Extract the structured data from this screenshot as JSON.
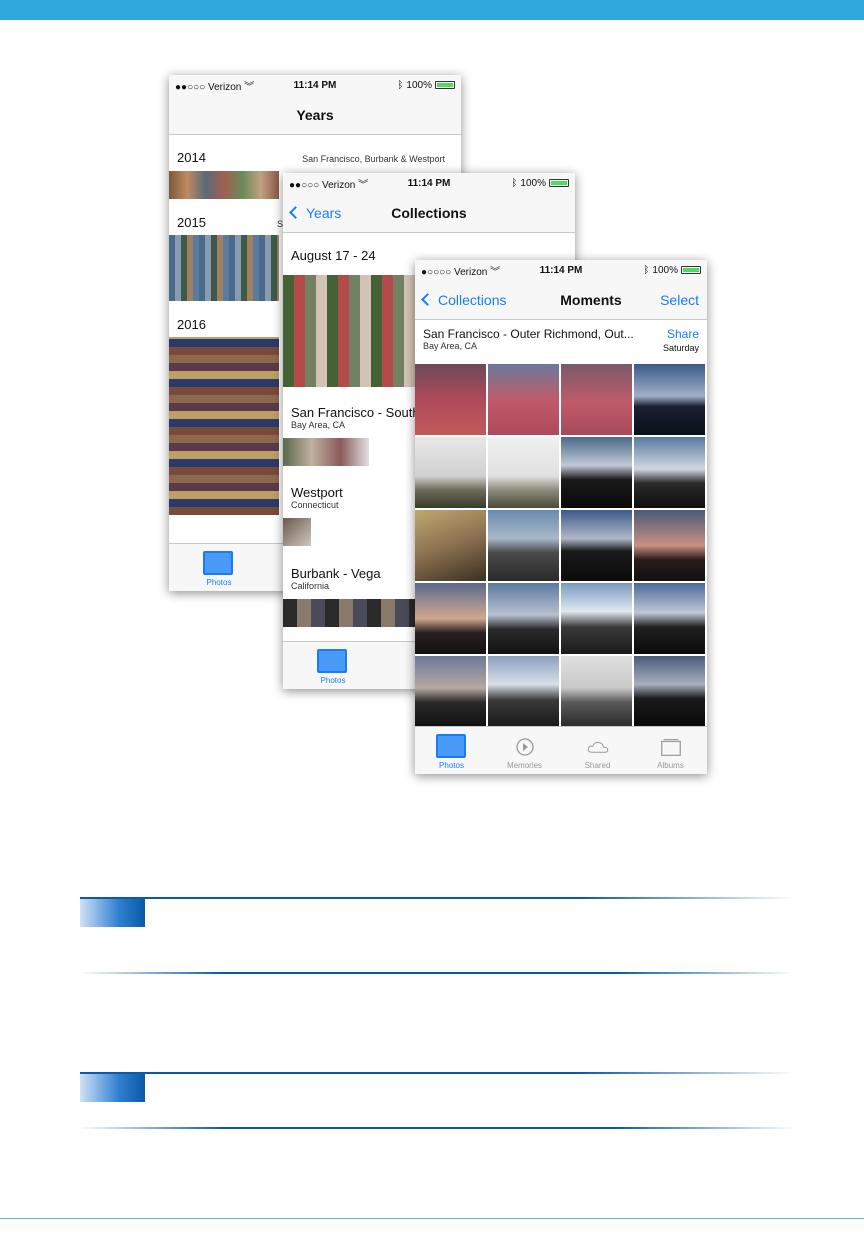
{
  "status": {
    "carrier": "Verizon",
    "time": "11:14 PM",
    "battery": "100%"
  },
  "years_screen": {
    "title": "Years",
    "rows": [
      {
        "year": "2014",
        "location": "San Francisco, Burbank & Westport"
      },
      {
        "year": "2015",
        "location": "S"
      },
      {
        "year": "2016",
        "location": ""
      }
    ],
    "tab_label": "Photos"
  },
  "collections_screen": {
    "back_label": "Years",
    "title": "Collections",
    "date_range": "August 17 - 24",
    "groups": [
      {
        "title": "San Francisco - South",
        "subtitle": "Bay Area, CA"
      },
      {
        "title": "Westport",
        "subtitle": "Connecticut"
      },
      {
        "title": "Burbank - Vega",
        "subtitle": "California"
      }
    ],
    "tab_label": "Photos"
  },
  "moments_screen": {
    "back_label": "Collections",
    "title": "Moments",
    "select_label": "Select",
    "location_title": "San Francisco - Outer Richmond, Out...",
    "location_sub": "Bay Area, CA",
    "share_label": "Share",
    "day_label": "Saturday",
    "tabs": [
      {
        "label": "Photos",
        "icon": "photos-icon",
        "active": true
      },
      {
        "label": "Memories",
        "icon": "memories-icon",
        "active": false
      },
      {
        "label": "Shared",
        "icon": "cloud-icon",
        "active": false
      },
      {
        "label": "Albums",
        "icon": "albums-icon",
        "active": false
      }
    ]
  },
  "colors": {
    "accent": "#1a7cf5",
    "header_bar": "#2fa8dd",
    "callout_rule": "#0a5aa8"
  }
}
